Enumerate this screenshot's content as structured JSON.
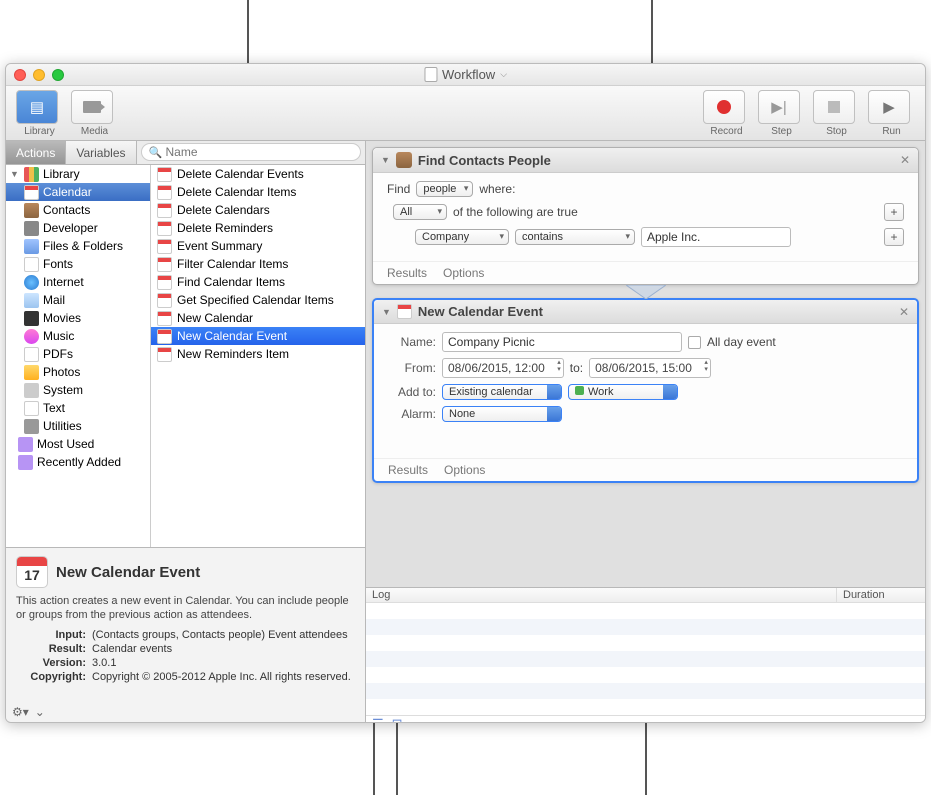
{
  "window": {
    "title": "Workflow"
  },
  "toolbar": {
    "library": "Library",
    "media": "Media",
    "record": "Record",
    "step": "Step",
    "stop": "Stop",
    "run": "Run"
  },
  "tabs": {
    "actions": "Actions",
    "variables": "Variables",
    "search_placeholder": "Name"
  },
  "library": {
    "root": "Library",
    "items": [
      {
        "label": "Calendar",
        "selected": true
      },
      {
        "label": "Contacts"
      },
      {
        "label": "Developer"
      },
      {
        "label": "Files & Folders"
      },
      {
        "label": "Fonts"
      },
      {
        "label": "Internet"
      },
      {
        "label": "Mail"
      },
      {
        "label": "Movies"
      },
      {
        "label": "Music"
      },
      {
        "label": "PDFs"
      },
      {
        "label": "Photos"
      },
      {
        "label": "System"
      },
      {
        "label": "Text"
      },
      {
        "label": "Utilities"
      }
    ],
    "extra": [
      {
        "label": "Most Used"
      },
      {
        "label": "Recently Added"
      }
    ]
  },
  "actions_list": [
    "Delete Calendar Events",
    "Delete Calendar Items",
    "Delete Calendars",
    "Delete Reminders",
    "Event Summary",
    "Filter Calendar Items",
    "Find Calendar Items",
    "Get Specified Calendar Items",
    "New Calendar",
    "New Calendar Event",
    "New Reminders Item"
  ],
  "actions_selected_index": 9,
  "info": {
    "title": "New Calendar Event",
    "desc": "This action creates a new event in Calendar. You can include people or groups from the previous action as attendees.",
    "input_label": "Input:",
    "input": "(Contacts groups, Contacts people) Event attendees",
    "result_label": "Result:",
    "result": "Calendar events",
    "version_label": "Version:",
    "version": "3.0.1",
    "copyright_label": "Copyright:",
    "copyright": "Copyright © 2005-2012 Apple Inc.  All rights reserved."
  },
  "workflow": {
    "action1": {
      "title": "Find Contacts People",
      "find": "Find",
      "people": "people",
      "where": "where:",
      "all": "All",
      "of_true": "of the following are true",
      "company": "Company",
      "contains": "contains",
      "value": "Apple Inc.",
      "results": "Results",
      "options": "Options"
    },
    "action2": {
      "title": "New Calendar Event",
      "name_label": "Name:",
      "name": "Company Picnic",
      "allday": "All day event",
      "from_label": "From:",
      "from": "08/06/2015, 12:00",
      "to_label": "to:",
      "to": "08/06/2015, 15:00",
      "addto_label": "Add to:",
      "addto": "Existing calendar",
      "calendar": "Work",
      "alarm_label": "Alarm:",
      "alarm": "None",
      "results": "Results",
      "options": "Options"
    }
  },
  "log": {
    "col1": "Log",
    "col2": "Duration"
  }
}
